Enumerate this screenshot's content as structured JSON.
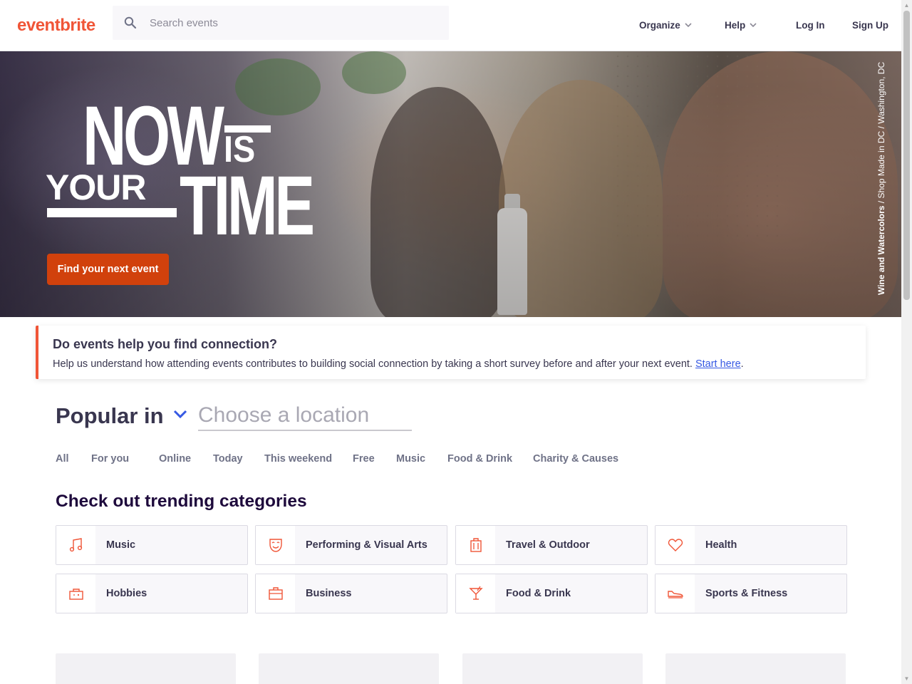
{
  "header": {
    "logo": "eventbrite",
    "search_placeholder": "Search events",
    "nav": {
      "organize": "Organize",
      "help": "Help",
      "login": "Log In",
      "signup": "Sign Up"
    }
  },
  "hero": {
    "headline": {
      "now": "NOW",
      "is": "IS",
      "your": "YOUR",
      "time": "TIME"
    },
    "cta": "Find your next event",
    "credit_bold": "Wine and Watercolors",
    "credit_rest": " / Shop Made in DC / Washington, DC"
  },
  "survey": {
    "title": "Do events help you find connection?",
    "text": "Help us understand how attending events contributes to building social connection by taking a short survey before and after your next event. ",
    "link": "Start here",
    "period": "."
  },
  "location": {
    "label": "Popular in",
    "placeholder": "Choose a location"
  },
  "tabs": [
    "All",
    "For you",
    "Online",
    "Today",
    "This weekend",
    "Free",
    "Music",
    "Food & Drink",
    "Charity & Causes"
  ],
  "trending": {
    "title": "Check out trending categories",
    "categories": [
      {
        "label": "Music",
        "icon": "music-note-icon"
      },
      {
        "label": "Performing & Visual Arts",
        "icon": "theater-mask-icon"
      },
      {
        "label": "Travel & Outdoor",
        "icon": "luggage-icon"
      },
      {
        "label": "Health",
        "icon": "heart-icon"
      },
      {
        "label": "Hobbies",
        "icon": "hobbies-icon"
      },
      {
        "label": "Business",
        "icon": "briefcase-icon"
      },
      {
        "label": "Food & Drink",
        "icon": "cocktail-icon"
      },
      {
        "label": "Sports & Fitness",
        "icon": "sneaker-icon"
      }
    ]
  },
  "colors": {
    "brand": "#f05537",
    "cta": "#d1410c",
    "link": "#3659e3",
    "heading": "#1e0a3c",
    "text": "#39364f",
    "tab_text": "#6f7287"
  }
}
